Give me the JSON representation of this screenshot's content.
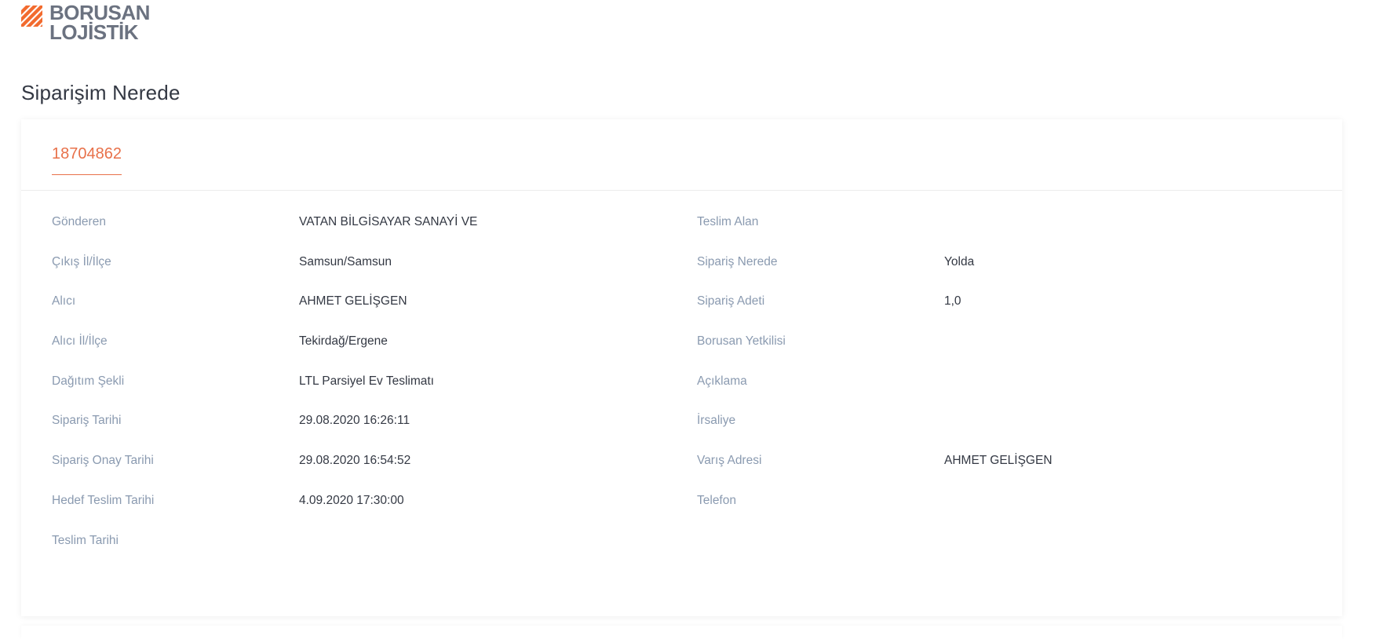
{
  "brand": {
    "line1": "BORUSAN",
    "line2": "LOJİSTİK",
    "accent_color": "#f26b2f",
    "icon": "borusan-stripe-logo-icon"
  },
  "page": {
    "title": "Siparişim Nerede"
  },
  "order": {
    "tab_label": "18704862",
    "left_fields": [
      {
        "label": "Gönderen",
        "value": "VATAN BİLGİSAYAR SANAYİ VE"
      },
      {
        "label": "Çıkış İl/İlçe",
        "value": "Samsun/Samsun"
      },
      {
        "label": "Alıcı",
        "value": "AHMET GELİŞGEN"
      },
      {
        "label": "Alıcı İl/İlçe",
        "value": "Tekirdağ/Ergene"
      },
      {
        "label": "Dağıtım Şekli",
        "value": "LTL Parsiyel Ev Teslimatı"
      },
      {
        "label": "Sipariş Tarihi",
        "value": "29.08.2020 16:26:11"
      },
      {
        "label": "Sipariş Onay Tarihi",
        "value": "29.08.2020 16:54:52"
      },
      {
        "label": "Hedef Teslim Tarihi",
        "value": "4.09.2020 17:30:00"
      },
      {
        "label": "Teslim Tarihi",
        "value": ""
      }
    ],
    "right_fields": [
      {
        "label": "Teslim Alan",
        "value": ""
      },
      {
        "label": "Sipariş Nerede",
        "value": "Yolda"
      },
      {
        "label": "Sipariş Adeti",
        "value": "1,0"
      },
      {
        "label": "Borusan Yetkilisi",
        "value": ""
      },
      {
        "label": "Açıklama",
        "value": ""
      },
      {
        "label": "İrsaliye",
        "value": ""
      },
      {
        "label": "Varış Adresi",
        "value": "AHMET GELİŞGEN"
      },
      {
        "label": "Telefon",
        "value": ""
      }
    ]
  },
  "colors": {
    "accent": "#e8714a",
    "label": "#8a9ab0",
    "value": "#333843"
  }
}
